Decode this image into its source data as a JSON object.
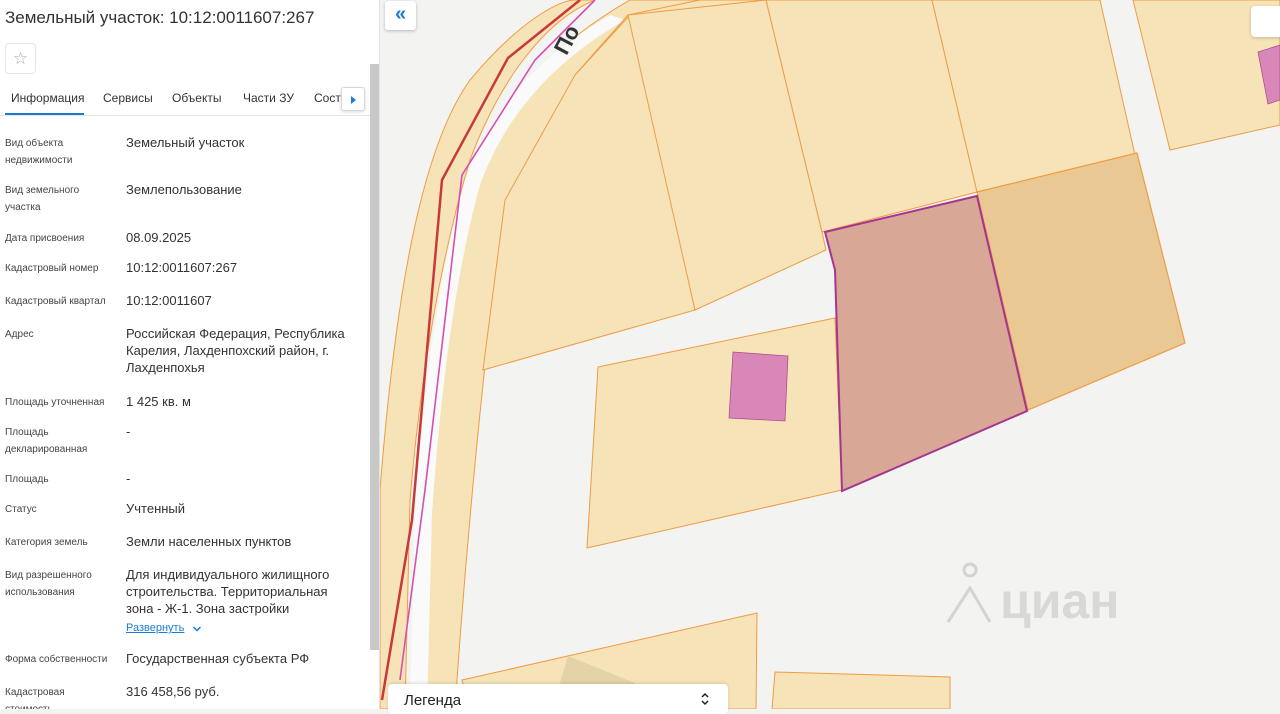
{
  "panel": {
    "title": "Земельный участок: 10:12:0011607:267",
    "favorite_icon": "star-outline-icon",
    "tabs": [
      {
        "label": "Информация",
        "active": true
      },
      {
        "label": "Сервисы",
        "active": false
      },
      {
        "label": "Объекты",
        "active": false
      },
      {
        "label": "Части ЗУ",
        "active": false
      },
      {
        "label": "Соста",
        "active": false
      }
    ],
    "tabs_next_icon": "caret-right-icon",
    "fields": [
      {
        "label": "Вид объекта недвижимости",
        "value": "Земельный участок"
      },
      {
        "label": "Вид земельного участка",
        "value": "Землепользование"
      },
      {
        "label": "Дата присвоения",
        "value": "08.09.2025"
      },
      {
        "label": "Кадастровый номер",
        "value": "10:12:0011607:267"
      },
      {
        "label": "Кадастровый квартал",
        "value": "10:12:0011607"
      },
      {
        "label": "Адрес",
        "value": "Российская Федерация, Республика Карелия, Лахденпохский район, г. Лахденпохья"
      },
      {
        "label": "Площадь уточненная",
        "value": "1 425 кв. м"
      },
      {
        "label": "Площадь декларированная",
        "value": "-"
      },
      {
        "label": "Площадь",
        "value": "-"
      },
      {
        "label": "Статус",
        "value": "Учтенный"
      },
      {
        "label": "Категория земель",
        "value": "Земли населенных пунктов"
      },
      {
        "label": "Вид разрешенного использования",
        "value": "Для индивидуального жилищного строительства. Территориальная зона - Ж-1. Зона застройки"
      },
      {
        "label": "Форма собственности",
        "value": "Государственная субъекта РФ"
      },
      {
        "label": "Кадастровая стоимость",
        "value": "316 458,56 руб."
      }
    ],
    "expand_label": "Развернуть",
    "expand_icon": "chevron-down-icon"
  },
  "map": {
    "collapse_label": "«",
    "collapse_icon": "double-chevron-left-icon",
    "street_label": "По",
    "legend_label": "Легенда",
    "legend_icon": "chevron-up-down-icon",
    "watermark_text": "циан",
    "watermark_icon": "cian-logo-icon",
    "colors": {
      "parcel_fill": "#f6e4b8",
      "parcel_border": "#ef9b43",
      "selected_fill": "#d9a795",
      "selected_border": "#a43590",
      "building_fill": "#d987b8",
      "road_line": "#c83a3a",
      "accent": "#1a7bd4"
    }
  }
}
